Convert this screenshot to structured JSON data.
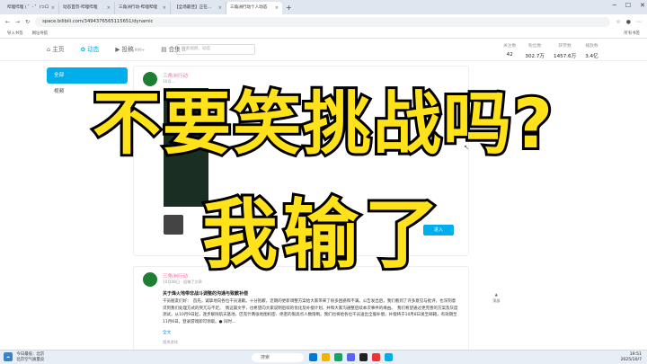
{
  "tabs": [
    {
      "label": "哔哩哔哩 ( ゜- ゜)つロ"
    },
    {
      "label": "动态首页-哔哩哔哩"
    },
    {
      "label": "三角洲行动-哔哩哔哩"
    },
    {
      "label": "【全场最佳】正在..."
    },
    {
      "label": "三角洲行动个人动态",
      "active": true
    }
  ],
  "address": {
    "url": "space.bilibili.com/3494376565115651/dynamic"
  },
  "bookmarks": {
    "import": "导入书签",
    "nav": "网址导航",
    "all": "所有书签"
  },
  "nav": {
    "home": "主页",
    "dynamic": "动态",
    "posts": "投稿",
    "posts_count": "999+",
    "collections": "合集",
    "collections_count": "11",
    "search_placeholder": "搜索视频、动态"
  },
  "stats": [
    {
      "label": "关注数",
      "value": "42"
    },
    {
      "label": "粉丝数",
      "value": "302.7万"
    },
    {
      "label": "获赞数",
      "value": "1457.6万"
    },
    {
      "label": "播放数",
      "value": "3.4亿"
    }
  ],
  "sidebar": {
    "items": [
      {
        "label": "全部"
      },
      {
        "label": "视频"
      }
    ]
  },
  "post1": {
    "user": "三角洲行动",
    "time": "10月..."
  },
  "post2": {
    "user": "三角洲行动",
    "time": "10月08日 · 投稿了文章",
    "title": "关于烽火地带非战斗调整的沟通与致歉补偿",
    "body": "干员朋友们好：　首先，诚挚地向各位干员道歉。十分抱歉，近期的更新调整方案给大家带来了很多困惑和不满。公告发出后，我们看到了许多意见与批评，也深刻意识到我们处理方式的突兀与不足。　情这篇文字，也希望向大家说明后续的优化及补偿计划，并和大家沟通整后续本次事件的缘由。　我们希望通过更完善的方案及灰度测试，从10月9日起，逐步解除航天基地、巴克什两张地图机密、绝密的限高点人数限制。我们也将给各位干员送出全服补偿，补偿将于10月8日发至邮箱，有效期至11月6日。登录游戏即可领取。● 同时...",
    "link": "全文",
    "tag": "相关游戏"
  },
  "join_button": "进入",
  "float_button": "顶部",
  "overlay": {
    "line1": "不要笑挑战吗?",
    "line2": "我输了"
  },
  "taskbar": {
    "weather_temp": "今日最低：北京",
    "weather_desc": "北京空气质量良",
    "search": "搜索",
    "time": "19:51",
    "date": "2025/10/7"
  },
  "colors": {
    "accent": "#00aeec",
    "pink": "#fb7299",
    "overlay_fill": "#ffe21a",
    "overlay_stroke": "#000000"
  }
}
